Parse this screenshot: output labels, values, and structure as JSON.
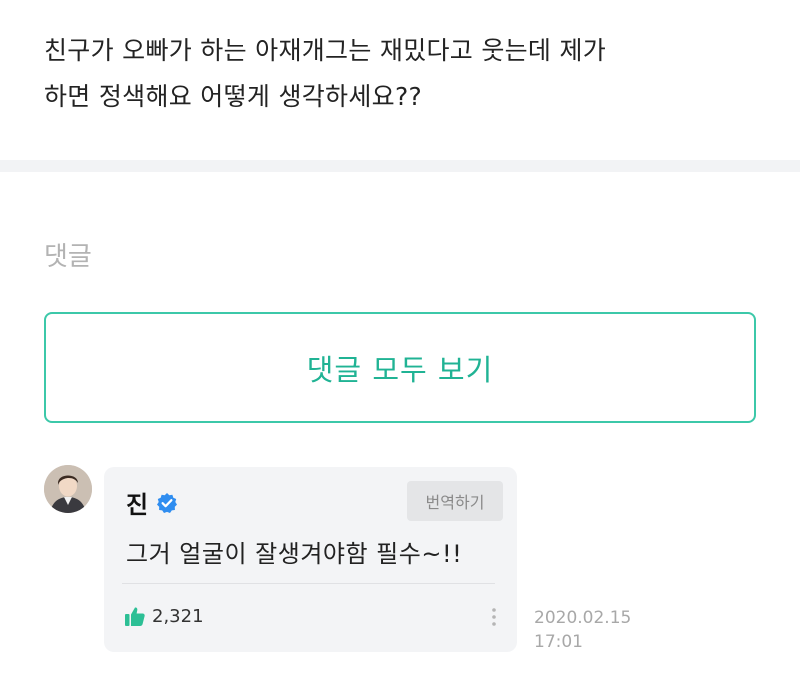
{
  "post": {
    "line1": "친구가 오빠가 하는 아재개그는 재밌다고 웃는데 제가",
    "line2": "하면 정색해요 어떻게 생각하세요??"
  },
  "comments_section": {
    "header": "댓글",
    "view_all_label": "댓글 모두 보기"
  },
  "comment": {
    "author": "진",
    "translate_label": "번역하기",
    "body": "그거 얼굴이 잘생겨야함 필수~!!",
    "likes": "2,321",
    "date": "2020.02.15",
    "time": "17:01"
  },
  "colors": {
    "accent": "#20b394",
    "accent_border": "#3cc8a9",
    "verified": "#2f8df0",
    "like": "#2cbf95",
    "bubble_bg": "#f3f4f6"
  },
  "icons": [
    "verified-badge-icon",
    "thumbs-up-icon",
    "more-options-icon"
  ]
}
